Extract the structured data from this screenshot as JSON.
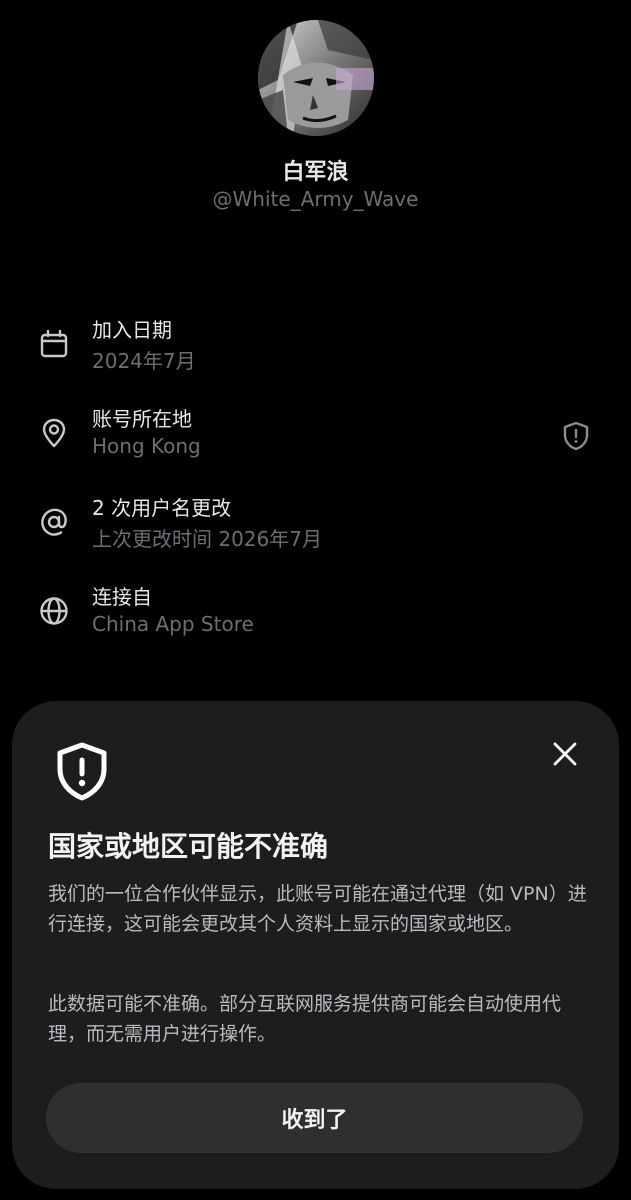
{
  "profile": {
    "display_name": "白军浪",
    "handle": "@White_Army_Wave"
  },
  "info": {
    "joined": {
      "icon": "calendar-icon",
      "title": "加入日期",
      "value": "2024年7月"
    },
    "location": {
      "icon": "location-pin-icon",
      "title": "账号所在地",
      "value": "Hong Kong",
      "trailing_icon": "shield-alert-icon"
    },
    "username_changes": {
      "icon": "at-sign-icon",
      "title": "2 次用户名更改",
      "value": "上次更改时间 2026年7月"
    },
    "connected_via": {
      "icon": "globe-icon",
      "title": "连接自",
      "value": "China App Store"
    }
  },
  "sheet": {
    "icon": "shield-alert-icon",
    "close_icon": "close-icon",
    "title": "国家或地区可能不准确",
    "paragraph1": "我们的一位合作伙伴显示，此账号可能在通过代理（如 VPN）进行连接，这可能会更改其个人资料上显示的国家或地区。",
    "paragraph2": "此数据可能不准确。部分互联网服务提供商可能会自动使用代理，而无需用户进行操作。",
    "button_label": "收到了"
  },
  "colors": {
    "background": "#000000",
    "primary_text": "#e7e9ea",
    "secondary_text": "#6b6f74",
    "sheet_background": "#1d1d1f",
    "button_background": "#2f2f31"
  }
}
